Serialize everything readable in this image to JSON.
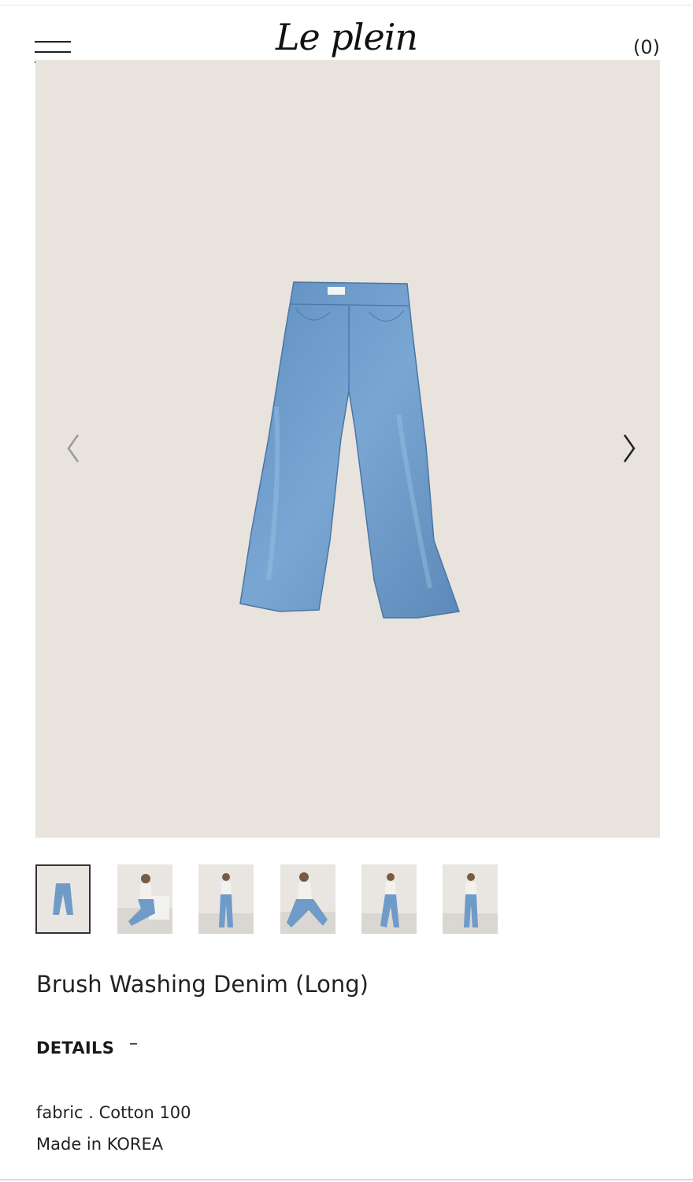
{
  "header": {
    "logo": "Le plein",
    "cart_label": "(0)"
  },
  "icons": {
    "menu": "hamburger-menu-icon",
    "prev": "chevron-left-icon",
    "next": "chevron-right-icon"
  },
  "gallery": {
    "background": "#e8e3dd",
    "denim_color": "#6f9bc8",
    "thumbnails": [
      {
        "label": "product flat lay",
        "active": true
      },
      {
        "label": "model sitting"
      },
      {
        "label": "model standing front"
      },
      {
        "label": "model sitting floor"
      },
      {
        "label": "model standing side"
      },
      {
        "label": "model standing back"
      }
    ]
  },
  "product": {
    "title": "Brush Washing Denim (Long)",
    "details_heading": "DETAILS",
    "details_toggle": "–",
    "details_lines": [
      "fabric . Cotton 100",
      "Made in KOREA"
    ]
  }
}
